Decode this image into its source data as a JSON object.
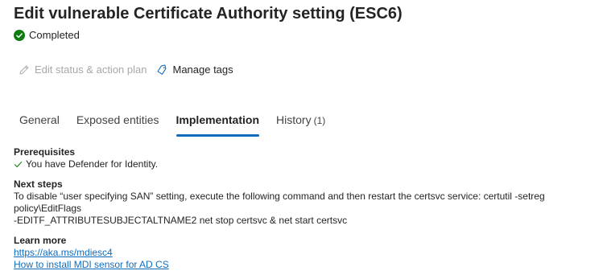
{
  "header": {
    "title": "Edit vulnerable Certificate Authority setting (ESC6)",
    "status": "Completed"
  },
  "actions": {
    "edit_status": "Edit status & action plan",
    "manage_tags": "Manage tags"
  },
  "tabs": [
    {
      "label": "General"
    },
    {
      "label": "Exposed entities"
    },
    {
      "label": "Implementation",
      "active": true
    },
    {
      "label": "History",
      "count": "(1)"
    }
  ],
  "prerequisites": {
    "title": "Prerequisites",
    "item": "You have Defender for Identity."
  },
  "next_steps": {
    "title": "Next steps",
    "line1": "To disable “user specifying SAN” setting, execute the following command and then restart the certsvc service: certutil -setreg policy\\EditFlags",
    "line2": "-EDITF_ATTRIBUTESUBJECTALTNAME2 net stop certsvc & net start certsvc"
  },
  "learn_more": {
    "title": "Learn more",
    "links": [
      "https://aka.ms/mdiesc4",
      "How to install MDI sensor for AD CS"
    ]
  },
  "colors": {
    "accent": "#0f6cbd",
    "success": "#107c10",
    "disabled": "#a8a8a8"
  }
}
